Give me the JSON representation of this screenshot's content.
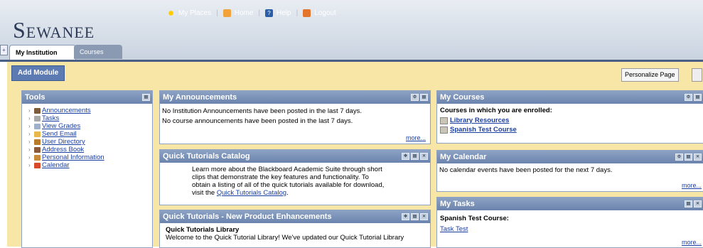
{
  "header": {
    "logo": "Sewanee",
    "links": [
      {
        "label": "My Places",
        "icon": "my-places-icon"
      },
      {
        "label": "Home",
        "icon": "home-icon"
      },
      {
        "label": "Help",
        "icon": "help-icon"
      },
      {
        "label": "Logout",
        "icon": "logout-icon"
      }
    ]
  },
  "tabs": {
    "institution": "My Institution",
    "courses": "Courses"
  },
  "toolbar": {
    "add_module": "Add Module",
    "personalize": "Personalize Page"
  },
  "tools": {
    "title": "Tools",
    "items": [
      {
        "label": "Announcements",
        "icon": "announcement-icon"
      },
      {
        "label": "Tasks",
        "icon": "tasks-icon"
      },
      {
        "label": "View Grades",
        "icon": "grades-icon"
      },
      {
        "label": "Send Email",
        "icon": "email-icon"
      },
      {
        "label": "User Directory",
        "icon": "directory-icon"
      },
      {
        "label": "Address Book",
        "icon": "address-book-icon"
      },
      {
        "label": "Personal Information",
        "icon": "personal-info-icon"
      },
      {
        "label": "Calendar",
        "icon": "calendar-icon"
      }
    ]
  },
  "announcements": {
    "title": "My Announcements",
    "line1": "No Institution Announcements have been posted in the last 7 days.",
    "line2": "No course announcements have been posted in the last 7 days.",
    "more": "more..."
  },
  "tutorials": {
    "title": "Quick Tutorials Catalog",
    "text": "Learn more about the Blackboard Academic Suite through short clips that demonstrate the key features and functionality. To obtain a listing of all of the quick tutorials available for download, visit the",
    "link": "Quick Tutorials Catalog",
    "end": "."
  },
  "enhancements": {
    "title": "Quick Tutorials - New Product Enhancements",
    "subtitle": "Quick Tutorials Library",
    "text": "Welcome to the Quick Tutorial Library! We've updated our Quick Tutorial Library"
  },
  "courses": {
    "title": "My Courses",
    "heading": "Courses in which you are enrolled:",
    "items": [
      "Library Resources",
      "Spanish Test Course"
    ]
  },
  "calendar": {
    "title": "My Calendar",
    "text": "No calendar events have been posted for the next 7 days.",
    "more": "more..."
  },
  "tasks": {
    "title": "My Tasks",
    "course": "Spanish Test Course:",
    "task": "Task Test",
    "more": "more..."
  }
}
